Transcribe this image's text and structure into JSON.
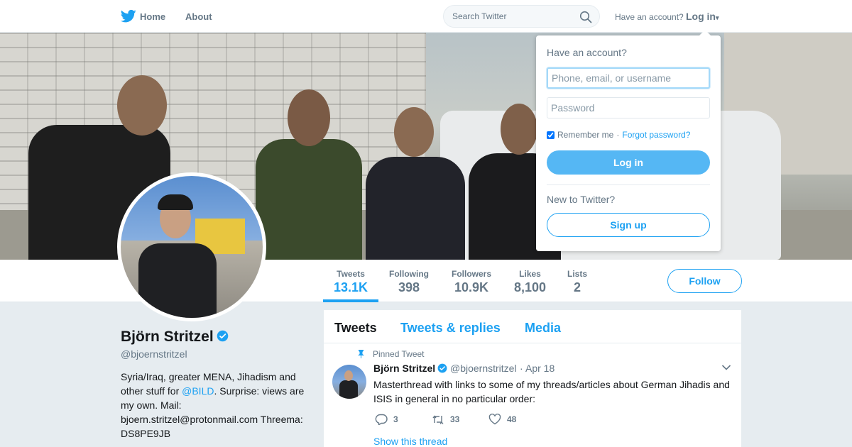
{
  "nav": {
    "home_label": "Home",
    "about_label": "About",
    "search_placeholder": "Search Twitter",
    "have_account": "Have an account?",
    "login_label": "Log in",
    "caret": "▾"
  },
  "profile": {
    "name": "Björn Stritzel",
    "handle": "@bjoernstritzel",
    "bio_before": "Syria/Iraq, greater MENA, Jihadism and other stuff for ",
    "bio_mention": "@BILD",
    "bio_after": ". Surprise: views are my own. Mail: bjoern.stritzel@protonmail.com Threema: DS8PE9JB"
  },
  "stats": [
    {
      "label": "Tweets",
      "value": "13.1K"
    },
    {
      "label": "Following",
      "value": "398"
    },
    {
      "label": "Followers",
      "value": "10.9K"
    },
    {
      "label": "Likes",
      "value": "8,100"
    },
    {
      "label": "Lists",
      "value": "2"
    }
  ],
  "follow_label": "Follow",
  "timeline": {
    "tabs": [
      "Tweets",
      "Tweets & replies",
      "Media"
    ],
    "pinned_label": "Pinned Tweet",
    "tweet": {
      "name": "Björn Stritzel",
      "handle": "@bjoernstritzel",
      "dot": "·",
      "date": "Apr 18",
      "text": "Masterthread with links to some of my threads/articles about German Jihadis and ISIS in general in no particular order:",
      "replies": "3",
      "retweets": "33",
      "likes": "48",
      "show_thread": "Show this thread"
    }
  },
  "login_dropdown": {
    "title": "Have an account?",
    "username_placeholder": "Phone, email, or username",
    "password_placeholder": "Password",
    "remember_label": "Remember me",
    "separator": "·",
    "forgot_label": "Forgot password?",
    "login_button": "Log in",
    "new_label": "New to Twitter?",
    "signup_button": "Sign up"
  },
  "colors": {
    "accent": "#1da1f2",
    "muted": "#657786",
    "background": "#e6ecf0"
  }
}
